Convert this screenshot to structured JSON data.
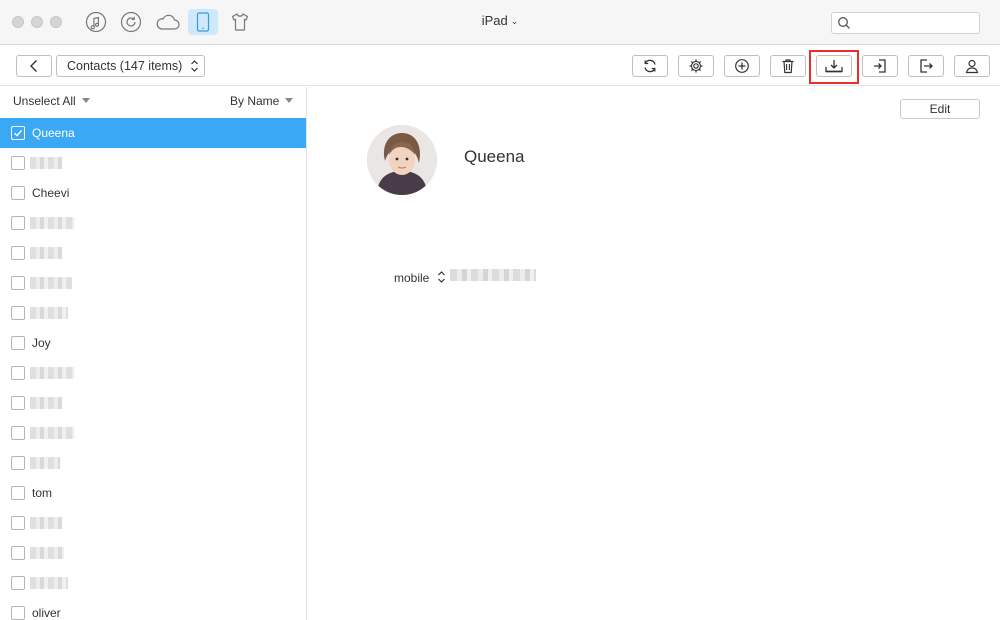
{
  "titlebar": {
    "device_title": "iPad",
    "nav_icons": [
      "music-note-icon",
      "history-icon",
      "cloud-icon",
      "ipad-device-icon",
      "tshirt-icon"
    ],
    "search": {
      "value": "",
      "placeholder": ""
    }
  },
  "toolbar": {
    "category_select": "Contacts (147 items)",
    "tools": [
      "refresh-icon",
      "settings-icon",
      "add-icon",
      "trash-icon",
      "export-to-computer-icon",
      "import-icon",
      "send-to-device-icon",
      "contact-icon"
    ]
  },
  "list": {
    "unselect_all": "Unselect All",
    "sort_by": "By Name",
    "contacts": [
      {
        "name": "Queena",
        "selected": true
      },
      {
        "name": "",
        "selected": false
      },
      {
        "name": "Cheevi",
        "selected": false
      },
      {
        "name": "",
        "selected": false
      },
      {
        "name": "",
        "selected": false
      },
      {
        "name": "",
        "selected": false
      },
      {
        "name": "",
        "selected": false
      },
      {
        "name": "Joy",
        "selected": false
      },
      {
        "name": "",
        "selected": false
      },
      {
        "name": "",
        "selected": false
      },
      {
        "name": "",
        "selected": false
      },
      {
        "name": "",
        "selected": false
      },
      {
        "name": "tom",
        "selected": false
      },
      {
        "name": "",
        "selected": false
      },
      {
        "name": "",
        "selected": false
      },
      {
        "name": "",
        "selected": false
      },
      {
        "name": "oliver",
        "selected": false
      }
    ]
  },
  "detail": {
    "edit_label": "Edit",
    "contact_name": "Queena",
    "phone_label": "mobile",
    "phone_value": ""
  },
  "colors": {
    "selection": "#3aa8f5",
    "active_tab": "#cfe8fb",
    "highlight_box": "#e53127"
  }
}
